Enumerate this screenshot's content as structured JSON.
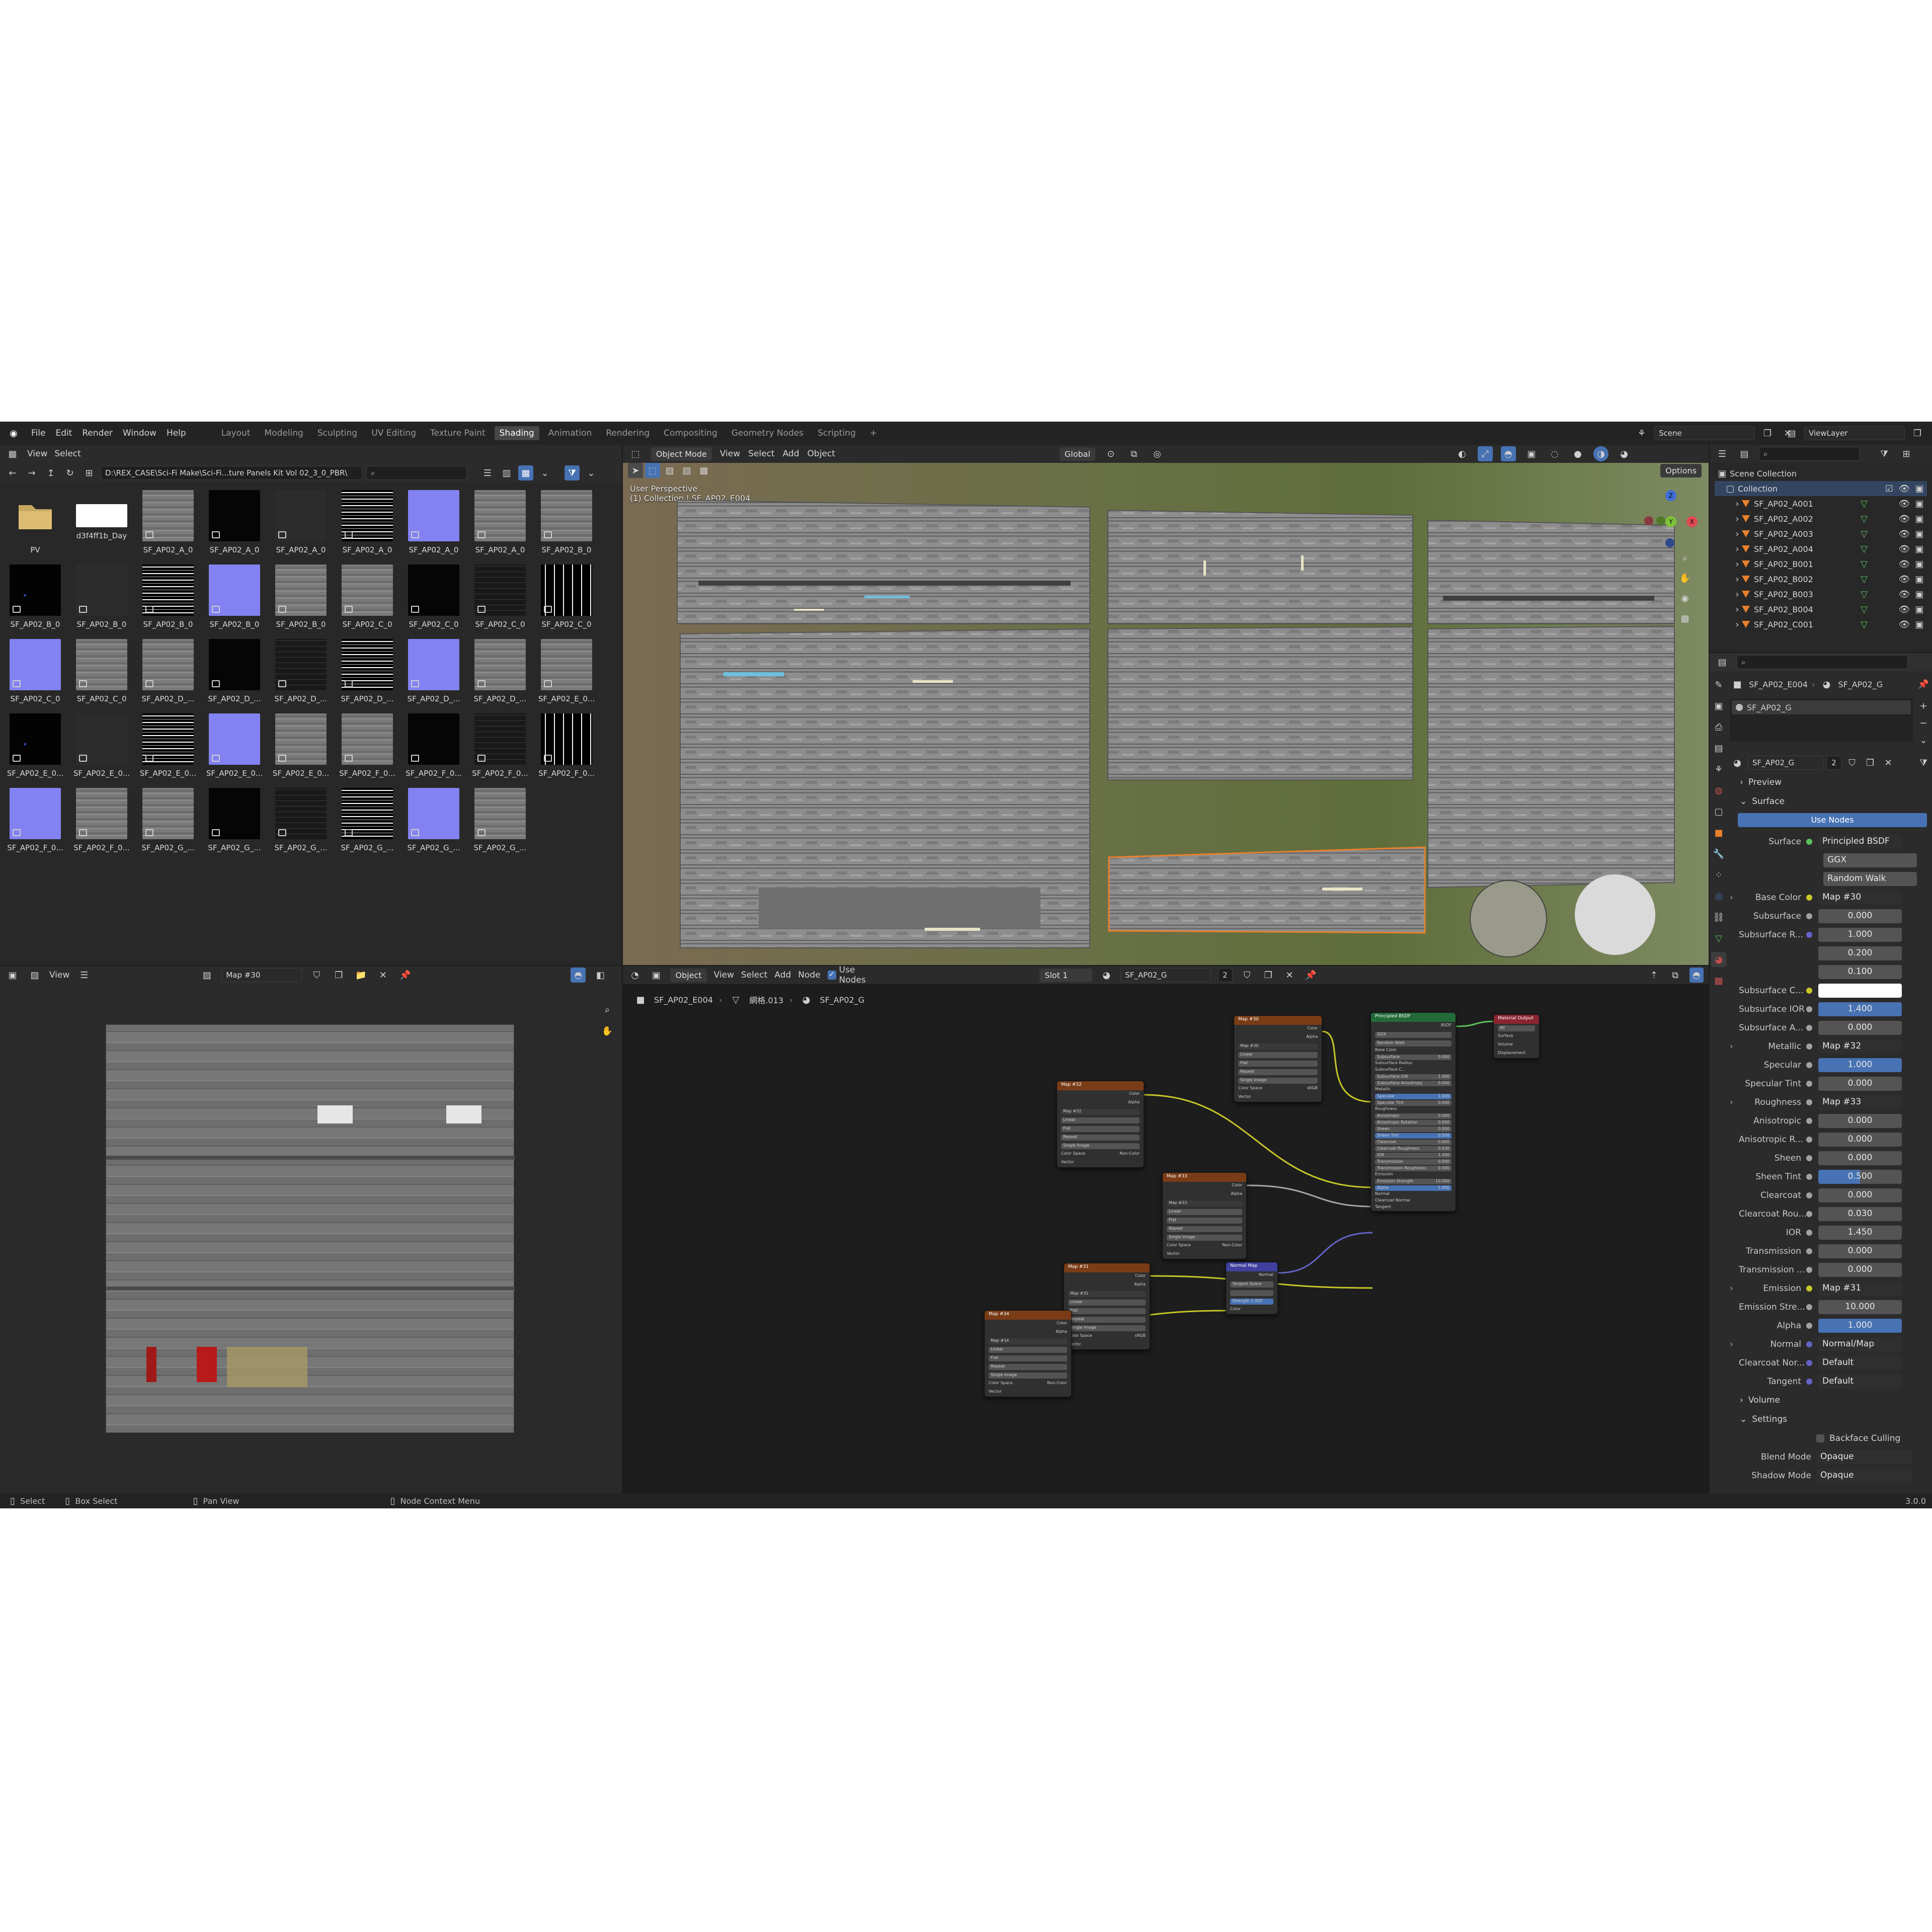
{
  "topbar": {
    "menus": [
      "File",
      "Edit",
      "Render",
      "Window",
      "Help"
    ],
    "workspaces": [
      "Layout",
      "Modeling",
      "Sculpting",
      "UV Editing",
      "Texture Paint",
      "Shading",
      "Animation",
      "Rendering",
      "Compositing",
      "Geometry Nodes",
      "Scripting"
    ],
    "active_workspace": "Shading",
    "add_symbol": "+",
    "scene": "Scene",
    "view_layer": "ViewLayer"
  },
  "file_browser": {
    "menus": [
      "View",
      "Select"
    ],
    "path": "D:\\REX_CASE\\Sci-Fi Make\\Sci-Fi...ture Panels Kit Vol 02_3_0_PBR\\",
    "items": [
      {
        "label": "PV",
        "kind": "folder"
      },
      {
        "label": "d3f4ff1b_Day",
        "kind": "white"
      },
      {
        "label": "SF_AP02_A_0",
        "kind": "gray"
      },
      {
        "label": "SF_AP02_A_0",
        "kind": "black"
      },
      {
        "label": "SF_AP02_A_0",
        "kind": "dark"
      },
      {
        "label": "SF_AP02_A_0",
        "kind": "bw"
      },
      {
        "label": "SF_AP02_A_0",
        "kind": "blue"
      },
      {
        "label": "SF_AP02_A_0",
        "kind": "gray"
      },
      {
        "label": "SF_AP02_B_0",
        "kind": "gray"
      },
      {
        "label": "SF_AP02_B_0",
        "kind": "blackdots"
      },
      {
        "label": "SF_AP02_B_0",
        "kind": "dark"
      },
      {
        "label": "SF_AP02_B_0",
        "kind": "bw"
      },
      {
        "label": "SF_AP02_B_0",
        "kind": "blue"
      },
      {
        "label": "SF_AP02_B_0",
        "kind": "gray"
      },
      {
        "label": "SF_AP02_C_0",
        "kind": "gray"
      },
      {
        "label": "SF_AP02_C_0",
        "kind": "black"
      },
      {
        "label": "SF_AP02_C_0",
        "kind": "darkline"
      },
      {
        "label": "SF_AP02_C_0",
        "kind": "bw2"
      },
      {
        "label": "SF_AP02_C_0",
        "kind": "blue"
      },
      {
        "label": "SF_AP02_C_0",
        "kind": "gray"
      },
      {
        "label": "SF_AP02_D_...",
        "kind": "gray"
      },
      {
        "label": "SF_AP02_D_...",
        "kind": "black"
      },
      {
        "label": "SF_AP02_D_...",
        "kind": "darkline"
      },
      {
        "label": "SF_AP02_D_...",
        "kind": "bw"
      },
      {
        "label": "SF_AP02_D_...",
        "kind": "blue"
      },
      {
        "label": "SF_AP02_D_...",
        "kind": "gray"
      },
      {
        "label": "SF_AP02_E_0...",
        "kind": "gray"
      },
      {
        "label": "SF_AP02_E_0...",
        "kind": "blackdots"
      },
      {
        "label": "SF_AP02_E_0...",
        "kind": "dark"
      },
      {
        "label": "SF_AP02_E_0...",
        "kind": "bw"
      },
      {
        "label": "SF_AP02_E_0...",
        "kind": "blue"
      },
      {
        "label": "SF_AP02_E_0...",
        "kind": "gray"
      },
      {
        "label": "SF_AP02_F_0...",
        "kind": "gray"
      },
      {
        "label": "SF_AP02_F_0...",
        "kind": "black"
      },
      {
        "label": "SF_AP02_F_0...",
        "kind": "darkline"
      },
      {
        "label": "SF_AP02_F_0...",
        "kind": "bw2"
      },
      {
        "label": "SF_AP02_F_0...",
        "kind": "blue"
      },
      {
        "label": "SF_AP02_F_0...",
        "kind": "gray"
      },
      {
        "label": "SF_AP02_G_...",
        "kind": "gray"
      },
      {
        "label": "SF_AP02_G_...",
        "kind": "black"
      },
      {
        "label": "SF_AP02_G_...",
        "kind": "darkline"
      },
      {
        "label": "SF_AP02_G_...",
        "kind": "bw"
      },
      {
        "label": "SF_AP02_G_...",
        "kind": "blue"
      },
      {
        "label": "SF_AP02_G_...",
        "kind": "gray"
      }
    ]
  },
  "viewport": {
    "mode": "Object Mode",
    "menus": [
      "View",
      "Select",
      "Add",
      "Object"
    ],
    "orientation": "Global",
    "options": "Options",
    "overlay_title": "User Perspective",
    "overlay_subtitle": "(1) Collection | SF_AP02_E004",
    "axis_z": "Z",
    "axis_y": "Y",
    "axis_x": "X"
  },
  "image_editor": {
    "menus": [
      "View"
    ],
    "image_name": "Map #30"
  },
  "node_editor": {
    "object_mode": "Object",
    "menus": [
      "View",
      "Select",
      "Add",
      "Node"
    ],
    "use_nodes": "Use Nodes",
    "slot": "Slot 1",
    "material": "SF_AP02_G",
    "users": "2",
    "breadcrumb": [
      "SF_AP02_E004",
      "網格.013",
      "SF_AP02_G"
    ]
  },
  "nodes": {
    "map30": {
      "title": "Map #30",
      "image": "Map #30",
      "rows": [
        "Linear",
        "Flat",
        "Repeat",
        "Single Image"
      ],
      "cs": "Color Space",
      "csv": "sRGB",
      "vector": "Vector",
      "color": "Color",
      "alpha": "Alpha"
    },
    "map32": {
      "title": "Map #32",
      "image": "Map #32",
      "rows": [
        "Linear",
        "Flat",
        "Repeat",
        "Single Image"
      ],
      "cs": "Color Space",
      "csv": "Non-Color",
      "vector": "Vector",
      "color": "Color",
      "alpha": "Alpha"
    },
    "map33": {
      "title": "Map #33",
      "image": "Map #33",
      "rows": [
        "Linear",
        "Flat",
        "Repeat",
        "Single Image"
      ],
      "cs": "Color Space",
      "csv": "Non-Color",
      "vector": "Vector",
      "color": "Color",
      "alpha": "Alpha"
    },
    "map31": {
      "title": "Map #31",
      "image": "Map #31",
      "rows": [
        "Linear",
        "Flat",
        "Repeat",
        "Single Image"
      ],
      "cs": "Color Space",
      "csv": "sRGB",
      "vector": "Vector",
      "color": "Color",
      "alpha": "Alpha"
    },
    "map34": {
      "title": "Map #34",
      "image": "Map #34",
      "rows": [
        "Linear",
        "Flat",
        "Repeat",
        "Single Image"
      ],
      "cs": "Color Space",
      "csv": "Non-Color",
      "vector": "Vector",
      "color": "Color",
      "alpha": "Alpha"
    },
    "normal_map": {
      "title": "Normal Map",
      "out": "Normal",
      "space": "Tangent Space",
      "strength": "Strength",
      "strength_v": "1.000",
      "color": "Color"
    },
    "bsdf": {
      "title": "Principled BSDF",
      "out": "BSDF",
      "dist": "GGX",
      "sss": "Random Walk",
      "rows": [
        [
          "Base Color",
          ""
        ],
        [
          "Subsurface",
          "0.000"
        ],
        [
          "Subsurface Radius",
          ""
        ],
        [
          "Subsurface C...",
          ""
        ],
        [
          "Subsurface IOR",
          "1.400"
        ],
        [
          "Subsurface Anisotropy",
          "0.000"
        ],
        [
          "Metallic",
          ""
        ],
        [
          "Specular",
          "1.000"
        ],
        [
          "Specular Tint",
          "0.000"
        ],
        [
          "Roughness",
          ""
        ],
        [
          "Anisotropic",
          "0.000"
        ],
        [
          "Anisotropic Rotation",
          "0.000"
        ],
        [
          "Sheen",
          "0.000"
        ],
        [
          "Sheen Tint",
          "0.500"
        ],
        [
          "Clearcoat",
          "0.000"
        ],
        [
          "Clearcoat Roughness",
          "0.030"
        ],
        [
          "IOR",
          "1.450"
        ],
        [
          "Transmission",
          "0.000"
        ],
        [
          "Transmission Roughness",
          "0.000"
        ],
        [
          "Emission",
          ""
        ],
        [
          "Emission Strength",
          "10.000"
        ],
        [
          "Alpha",
          "1.000"
        ],
        [
          "Normal",
          ""
        ],
        [
          "Clearcoat Normal",
          ""
        ],
        [
          "Tangent",
          ""
        ]
      ]
    },
    "output": {
      "title": "Material Output",
      "target": "All",
      "rows": [
        "Surface",
        "Volume",
        "Displacement"
      ]
    }
  },
  "outliner": {
    "root": "Scene Collection",
    "collection": "Collection",
    "items": [
      "SF_AP02_A001",
      "SF_AP02_A002",
      "SF_AP02_A003",
      "SF_AP02_A004",
      "SF_AP02_B001",
      "SF_AP02_B002",
      "SF_AP02_B003",
      "SF_AP02_B004",
      "SF_AP02_C001"
    ]
  },
  "properties": {
    "object": "SF_AP02_E004",
    "material_header": "SF_AP02_G",
    "slot_item": "SF_AP02_G",
    "material": "SF_AP02_G",
    "users": "2",
    "preview": "Preview",
    "surface_section": "Surface",
    "use_nodes": "Use Nodes",
    "surface_label": "Surface",
    "surface_value": "Principled BSDF",
    "distribution": "GGX",
    "sss_method": "Random Walk",
    "rows": [
      {
        "label": "Base Color",
        "value": "Map #30",
        "dot": "#c7c729",
        "kind": "link",
        "arrow": true
      },
      {
        "label": "Subsurface",
        "value": "0.000",
        "dot": "#a1a1a1",
        "kind": "num"
      },
      {
        "label": "Subsurface R...",
        "value": "1.000",
        "dot": "#6363c7",
        "kind": "num"
      },
      {
        "label": "",
        "value": "0.200",
        "dot": "",
        "kind": "num"
      },
      {
        "label": "",
        "value": "0.100",
        "dot": "",
        "kind": "num"
      },
      {
        "label": "Subsurface C...",
        "value": "",
        "dot": "#c7c729",
        "kind": "white"
      },
      {
        "label": "Subsurface IOR",
        "value": "1.400",
        "dot": "#a1a1a1",
        "kind": "blue"
      },
      {
        "label": "Subsurface A...",
        "value": "0.000",
        "dot": "#a1a1a1",
        "kind": "num"
      },
      {
        "label": "Metallic",
        "value": "Map #32",
        "dot": "#a1a1a1",
        "kind": "link",
        "arrow": true
      },
      {
        "label": "Specular",
        "value": "1.000",
        "dot": "#a1a1a1",
        "kind": "blue"
      },
      {
        "label": "Specular Tint",
        "value": "0.000",
        "dot": "#a1a1a1",
        "kind": "num"
      },
      {
        "label": "Roughness",
        "value": "Map #33",
        "dot": "#a1a1a1",
        "kind": "link",
        "arrow": true
      },
      {
        "label": "Anisotropic",
        "value": "0.000",
        "dot": "#a1a1a1",
        "kind": "num"
      },
      {
        "label": "Anisotropic R...",
        "value": "0.000",
        "dot": "#a1a1a1",
        "kind": "num"
      },
      {
        "label": "Sheen",
        "value": "0.000",
        "dot": "#a1a1a1",
        "kind": "num"
      },
      {
        "label": "Sheen Tint",
        "value": "0.500",
        "dot": "#a1a1a1",
        "kind": "half"
      },
      {
        "label": "Clearcoat",
        "value": "0.000",
        "dot": "#a1a1a1",
        "kind": "num"
      },
      {
        "label": "Clearcoat Rou...",
        "value": "0.030",
        "dot": "#a1a1a1",
        "kind": "num"
      },
      {
        "label": "IOR",
        "value": "1.450",
        "dot": "#a1a1a1",
        "kind": "num"
      },
      {
        "label": "Transmission",
        "value": "0.000",
        "dot": "#a1a1a1",
        "kind": "num"
      },
      {
        "label": "Transmission ...",
        "value": "0.000",
        "dot": "#a1a1a1",
        "kind": "num"
      },
      {
        "label": "Emission",
        "value": "Map #31",
        "dot": "#c7c729",
        "kind": "link",
        "arrow": true
      },
      {
        "label": "Emission Stre...",
        "value": "10.000",
        "dot": "#a1a1a1",
        "kind": "num"
      },
      {
        "label": "Alpha",
        "value": "1.000",
        "dot": "#a1a1a1",
        "kind": "blue"
      },
      {
        "label": "Normal",
        "value": "Normal/Map",
        "dot": "#6363c7",
        "kind": "link",
        "arrow": true
      },
      {
        "label": "Clearcoat Nor...",
        "value": "Default",
        "dot": "#6363c7",
        "kind": "link"
      },
      {
        "label": "Tangent",
        "value": "Default",
        "dot": "#6363c7",
        "kind": "link"
      }
    ],
    "volume": "Volume",
    "settings": "Settings",
    "backface": "Backface Culling",
    "blend_label": "Blend Mode",
    "blend_value": "Opaque",
    "shadow_label": "Shadow Mode",
    "shadow_value": "Opaque"
  },
  "statusbar": {
    "items": [
      "Select",
      "Box Select",
      "Pan View",
      "Node Context Menu"
    ],
    "version": "3.0.0"
  },
  "colors": {
    "accent": "#4772b3",
    "select": "#e8812e",
    "texture_header": "#7a3c16",
    "shader_header": "#236a39"
  }
}
